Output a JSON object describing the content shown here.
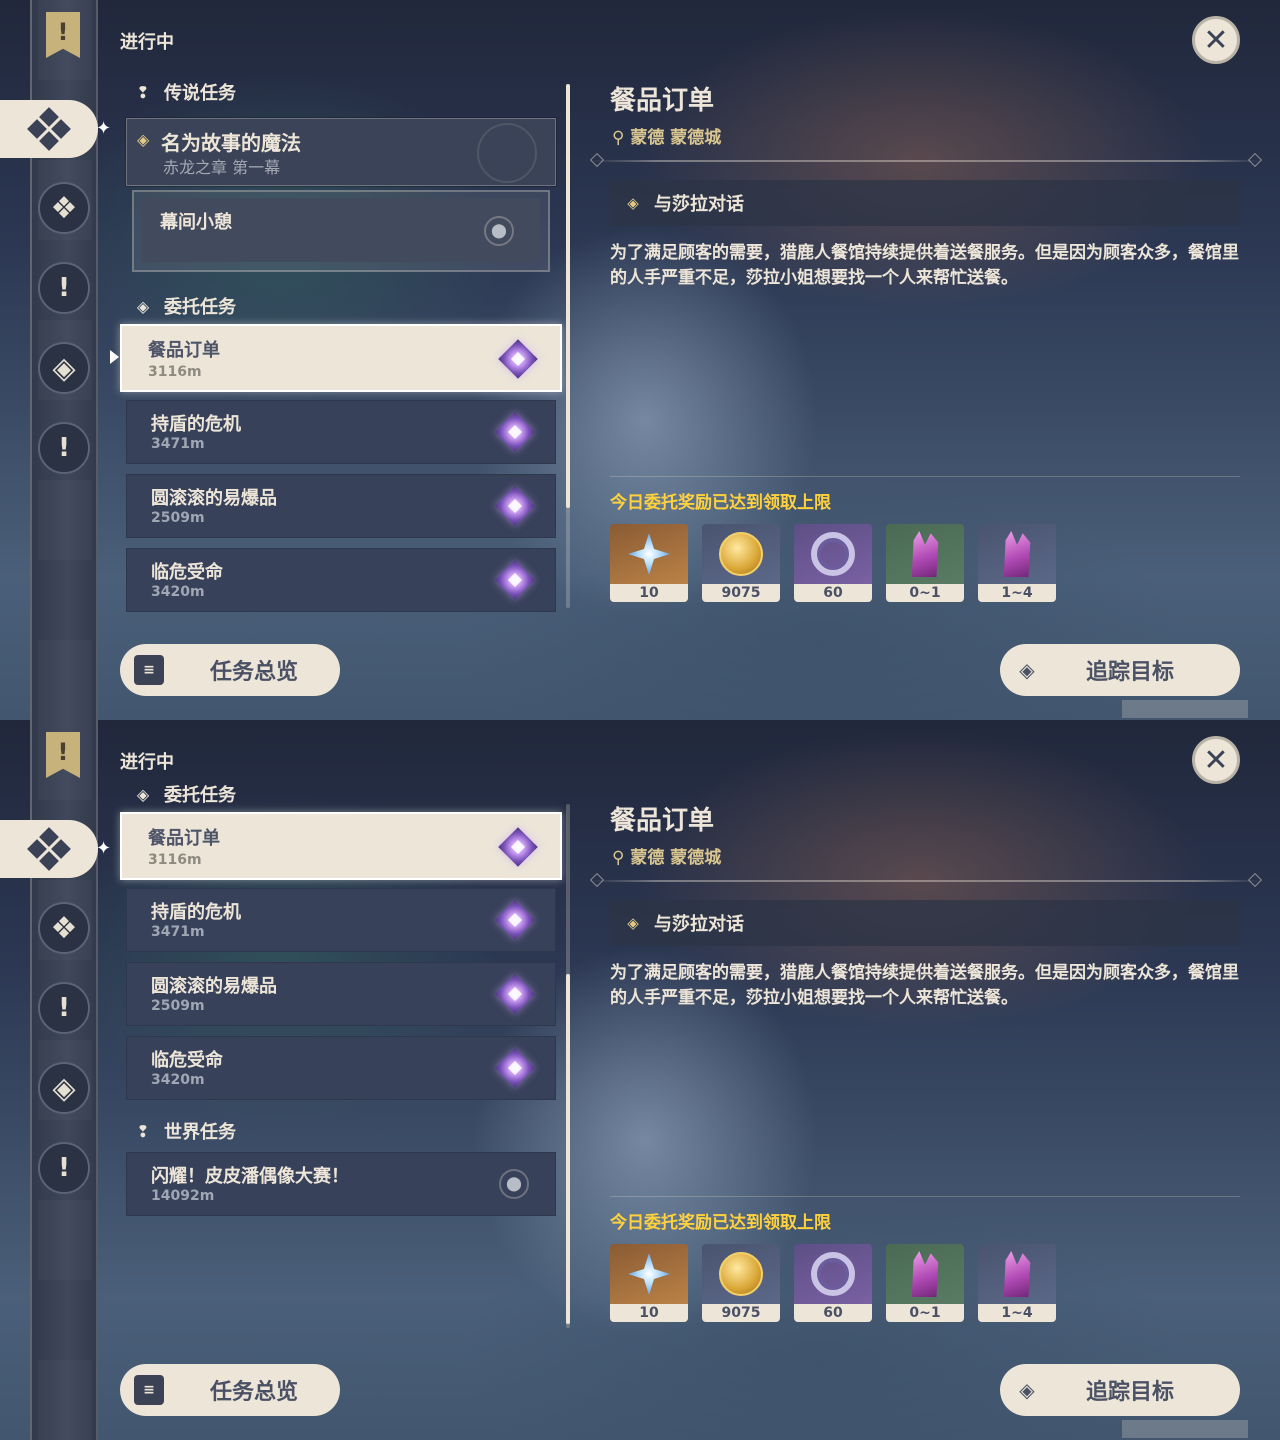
{
  "screens": [
    {
      "section_title": "进行中",
      "archon_category": "传说任务",
      "archon_quest": {
        "title": "名为故事的魔法",
        "subtitle": "赤龙之章 第一幕"
      },
      "archon_subquest": "幕间小憩",
      "commission_category": "委托任务",
      "quests": [
        {
          "title": "餐品订单",
          "distance": "3116m"
        },
        {
          "title": "持盾的危机",
          "distance": "3471m"
        },
        {
          "title": "圆滚滚的易爆品",
          "distance": "2509m"
        },
        {
          "title": "临危受命",
          "distance": "3420m"
        }
      ],
      "overview_button": "任务总览",
      "track_button": "追踪目标",
      "detail": {
        "title": "餐品订单",
        "location": "蒙德 蒙德城",
        "objective": "与莎拉对话",
        "description": "为了满足顾客的需要，猎鹿人餐馆持续提供着送餐服务。但是因为顾客众多，餐馆里的人手严重不足，莎拉小姐想要找一个人来帮忙送餐。",
        "reward_notice": "今日委托奖励已达到领取上限",
        "rewards": [
          {
            "icon": "primogem-icon",
            "count": "10"
          },
          {
            "icon": "mora-icon",
            "count": "9075"
          },
          {
            "icon": "adventure-exp-icon",
            "count": "60"
          },
          {
            "icon": "crystal-green-icon",
            "count": "0~1"
          },
          {
            "icon": "crystal-blue-icon",
            "count": "1~4"
          }
        ]
      }
    },
    {
      "section_title": "进行中",
      "commission_category": "委托任务",
      "quests": [
        {
          "title": "餐品订单",
          "distance": "3116m"
        },
        {
          "title": "持盾的危机",
          "distance": "3471m"
        },
        {
          "title": "圆滚滚的易爆品",
          "distance": "2509m"
        },
        {
          "title": "临危受命",
          "distance": "3420m"
        }
      ],
      "world_category": "世界任务",
      "world_quest": {
        "title": "闪耀！皮皮潘偶像大赛！",
        "distance": "14092m"
      },
      "overview_button": "任务总览",
      "track_button": "追踪目标",
      "detail": {
        "title": "餐品订单",
        "location": "蒙德 蒙德城",
        "objective": "与莎拉对话",
        "description": "为了满足顾客的需要，猎鹿人餐馆持续提供着送餐服务。但是因为顾客众多，餐馆里的人手严重不足，莎拉小姐想要找一个人来帮忙送餐。",
        "reward_notice": "今日委托奖励已达到领取上限",
        "rewards": [
          {
            "icon": "primogem-icon",
            "count": "10"
          },
          {
            "icon": "mora-icon",
            "count": "9075"
          },
          {
            "icon": "adventure-exp-icon",
            "count": "60"
          },
          {
            "icon": "crystal-green-icon",
            "count": "0~1"
          },
          {
            "icon": "crystal-blue-icon",
            "count": "1~4"
          }
        ]
      }
    }
  ],
  "colors": {
    "accent_gold": "#d9c690",
    "notice_yellow": "#ffd23c",
    "card_cream": "#ece5d8",
    "card_dark": "#38415a"
  }
}
